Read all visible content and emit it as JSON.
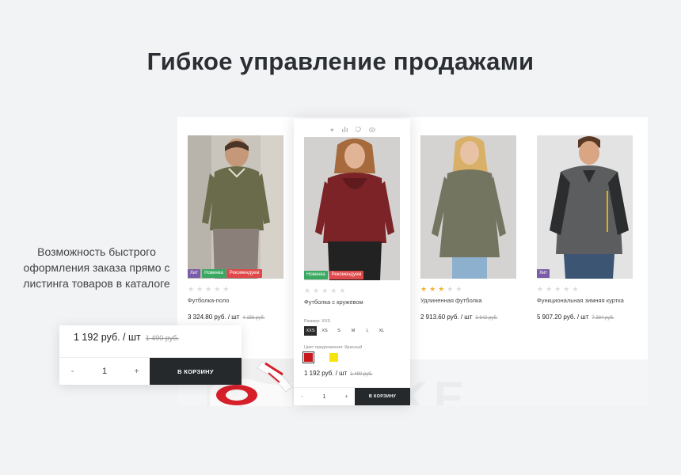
{
  "heading": "Гибкое управление продажами",
  "side_text": "Возможность быстрого оформления заказа прямо с листинга товаров в каталоге",
  "watermark": "NIKE",
  "products": [
    {
      "name": "Футболка-поло",
      "price": "3 324.80 руб. / шт",
      "old_price": "4 156 руб.",
      "badges": [
        "Хит",
        "Новинка",
        "Рекомендуем"
      ],
      "rating": 0
    },
    {
      "name": "Футболка с кружевом",
      "price": "1 192 руб. / шт",
      "old_price": "1 490 руб.",
      "badges": [
        "Новинка",
        "Рекомендуем"
      ],
      "rating": 0,
      "size_label": "Размер:",
      "size_value": "XXS",
      "sizes": [
        "XXS",
        "XS",
        "S",
        "M",
        "L",
        "XL"
      ],
      "color_label": "Цвет предложения:",
      "color_value": "Красный",
      "colors": [
        "#c8191e",
        "#ffffff",
        "#f5e50c"
      ],
      "qty": "1",
      "minus": "-",
      "plus": "+",
      "cart": "В КОРЗИНУ"
    },
    {
      "name": "Удлиненная футболка",
      "price": "2 913.60 руб. / шт",
      "old_price": "3 642 руб.",
      "badges": [],
      "rating": 3
    },
    {
      "name": "Функциональная зимняя куртка",
      "price": "5 907.20 руб. / шт",
      "old_price": "7 384 руб.",
      "badges": [
        "Хит"
      ],
      "rating": 0
    }
  ],
  "zoom": {
    "price": "1 192 руб. / шт",
    "old_price": "1 490 руб.",
    "minus": "-",
    "qty": "1",
    "plus": "+",
    "cart": "В КОРЗИНУ"
  },
  "icons": [
    "heart-icon",
    "compare-icon",
    "tag-icon",
    "eye-icon"
  ],
  "colors": {
    "accent_dark": "#26292c",
    "badge_hit": "#7a5da8",
    "badge_new": "#3aa860",
    "badge_rec": "#e0484a",
    "star": "#f3b233"
  }
}
